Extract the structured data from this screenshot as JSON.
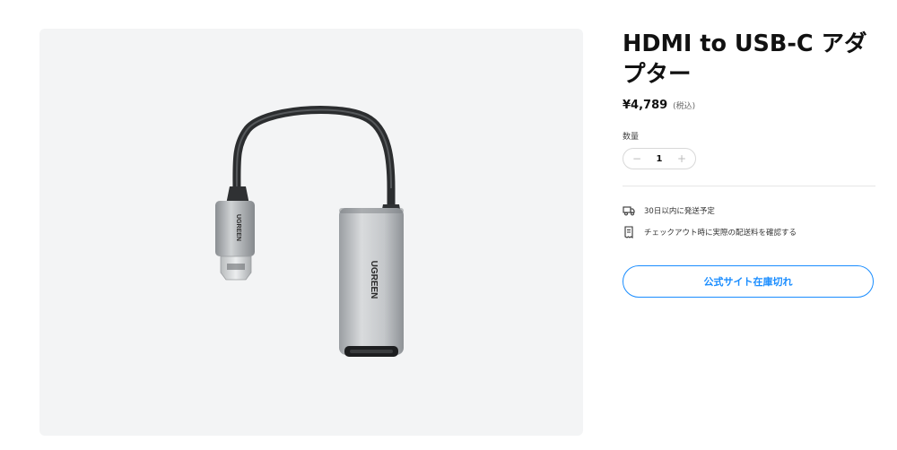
{
  "product": {
    "title": "HDMI to USB-C アダプター",
    "price": "¥4,789",
    "tax_note": "(税込)",
    "brand": "UGREEN",
    "image": "hdmi-usb-c-adapter-image"
  },
  "quantity": {
    "label": "数量",
    "value": "1",
    "minus": "−",
    "plus": "+"
  },
  "shipping": {
    "delivery_text": "30日以内に発送予定",
    "delivery_icon": "truck-icon",
    "checkout_text": "チェックアウト時に実際の配送料を確認する",
    "checkout_icon": "receipt-icon"
  },
  "cta": {
    "label": "公式サイト在庫切れ"
  },
  "colors": {
    "accent": "#1a8dff",
    "image_background": "#f3f4f5"
  }
}
